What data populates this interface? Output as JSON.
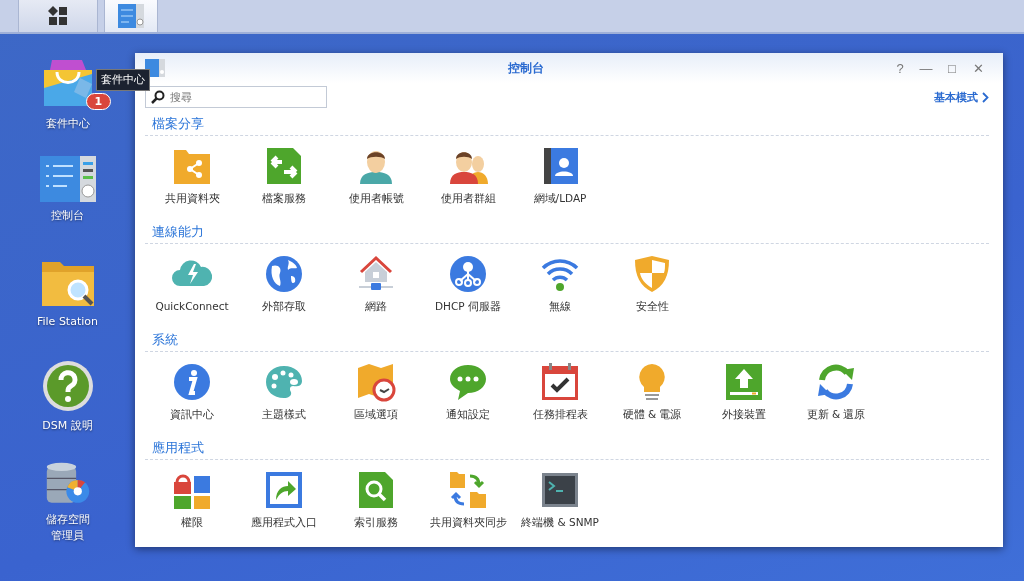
{
  "taskbar": [
    {
      "selected": false
    },
    {
      "selected": true
    }
  ],
  "desktop": [
    {
      "label": "套件中心",
      "badge": "1"
    },
    {
      "label": "控制台"
    },
    {
      "label": "File Station"
    },
    {
      "label": "DSM 說明"
    },
    {
      "lines": [
        "儲存空間",
        "管理員"
      ]
    }
  ],
  "tooltip": "套件中心",
  "window": {
    "title": "控制台",
    "controls": [
      "?",
      "—",
      "□",
      "✕"
    ],
    "search": {
      "placeholder": "搜尋"
    },
    "mode_link": "基本模式"
  },
  "sections": [
    {
      "title": "檔案分享",
      "items": [
        "共用資料夾",
        "檔案服務",
        "使用者帳號",
        "使用者群組",
        "網域/LDAP"
      ]
    },
    {
      "title": "連線能力",
      "items": [
        "QuickConnect",
        "外部存取",
        "網路",
        "DHCP 伺服器",
        "無線",
        "安全性"
      ]
    },
    {
      "title": "系統",
      "items": [
        "資訊中心",
        "主題樣式",
        "區域選項",
        "通知設定",
        "任務排程表",
        "硬體 & 電源",
        "外接裝置",
        "更新 & 還原"
      ]
    },
    {
      "title": "應用程式",
      "items": [
        "權限",
        "應用程式入口",
        "索引服務",
        "共用資料夾同步",
        "終端機 & SNMP"
      ]
    }
  ]
}
